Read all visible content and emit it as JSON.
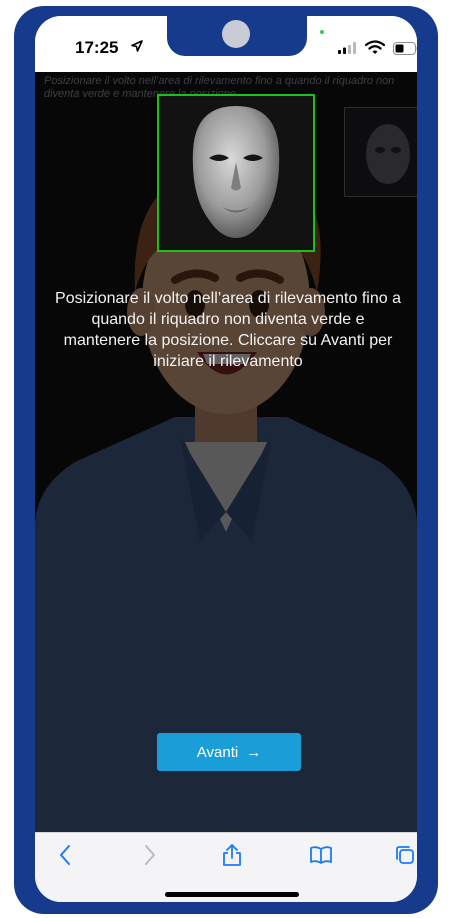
{
  "status_bar": {
    "time": "17:25"
  },
  "overlay_text": "Posizionare il volto nell’area di rilevamento fino a quando il riquadro non diventa verde e mantenere la posizione.",
  "instruction": "Posizionare il volto nell’area di rilevamento fino a quando il riquadro non diventa verde e mantenere la posizione. Cliccare su Avanti per iniziare il rilevamento",
  "button": {
    "label": "Avanti",
    "arrow": "→"
  },
  "colors": {
    "frame": "#163b8c",
    "detect_box": "#19c219",
    "button": "#1a9ed8"
  },
  "toolbar": {
    "icons": [
      "back-icon",
      "forward-icon",
      "share-icon",
      "bookmarks-icon",
      "tabs-icon"
    ]
  }
}
